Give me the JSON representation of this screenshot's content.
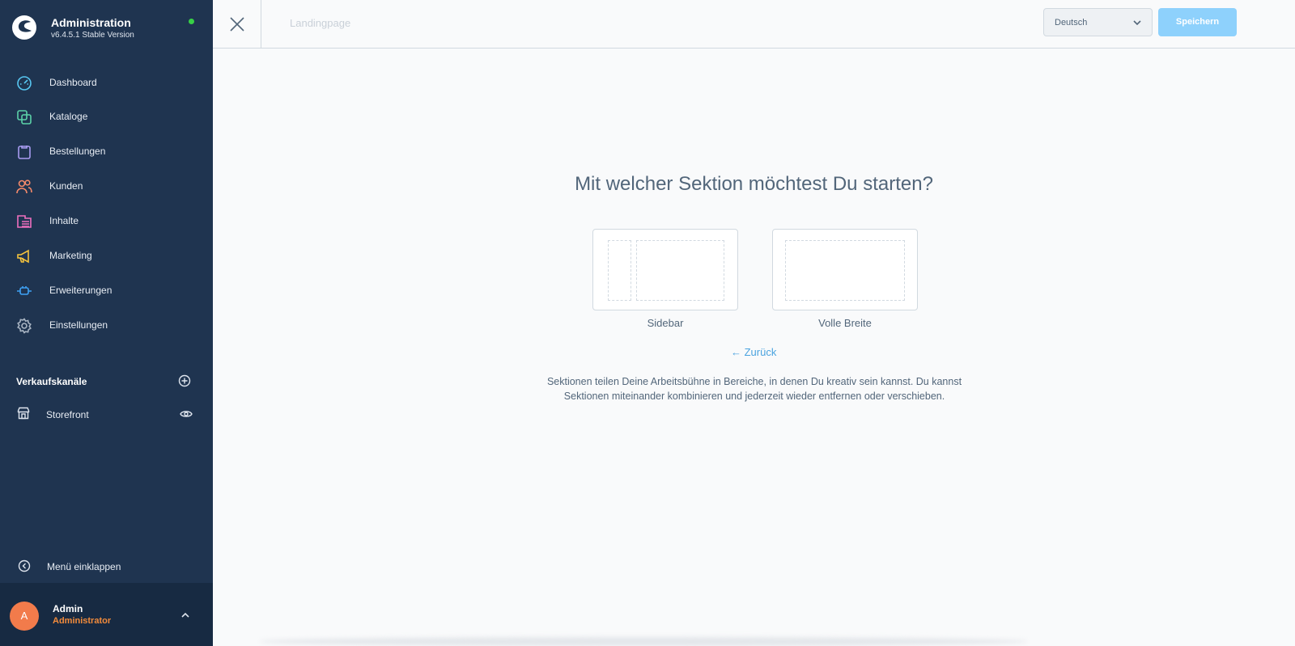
{
  "brand": {
    "title": "Administration",
    "version": "v6.4.5.1 Stable Version"
  },
  "nav": {
    "items": [
      {
        "label": "Dashboard",
        "icon": "gauge-icon",
        "color": "#57c7f2"
      },
      {
        "label": "Kataloge",
        "icon": "catalog-icon",
        "color": "#5bd1a8"
      },
      {
        "label": "Bestellungen",
        "icon": "clipboard-icon",
        "color": "#a89bf0"
      },
      {
        "label": "Kunden",
        "icon": "users-icon",
        "color": "#f58a6b"
      },
      {
        "label": "Inhalte",
        "icon": "content-icon",
        "color": "#ee6fbe"
      },
      {
        "label": "Marketing",
        "icon": "megaphone-icon",
        "color": "#f5c33c"
      },
      {
        "label": "Erweiterungen",
        "icon": "plugin-icon",
        "color": "#3ea2f5"
      },
      {
        "label": "Einstellungen",
        "icon": "gear-icon",
        "color": "#a9b5c3"
      }
    ]
  },
  "sales_channels": {
    "heading": "Verkaufskanäle",
    "items": [
      {
        "label": "Storefront"
      }
    ]
  },
  "collapse_label": "Menü einklappen",
  "user": {
    "initial": "A",
    "name": "Admin",
    "role": "Administrator"
  },
  "topbar": {
    "page_name": "Landingpage",
    "language": "Deutsch",
    "save_label": "Speichern"
  },
  "main": {
    "question": "Mit welcher Sektion möchtest Du starten?",
    "options": [
      {
        "label": "Sidebar"
      },
      {
        "label": "Volle Breite"
      }
    ],
    "back_label": "← Zurück",
    "help_text": "Sektionen teilen Deine Arbeitsbühne in Bereiche, in denen Du kreativ sein kannst. Du kannst Sektionen miteinander kombinieren und jederzeit wieder entfernen oder verschieben."
  },
  "colors": {
    "sidebar": "#1f3450",
    "accent": "#4aa3df",
    "save_button": "#8ed1fc",
    "avatar": "#f27b4b",
    "status": "#37d046"
  }
}
